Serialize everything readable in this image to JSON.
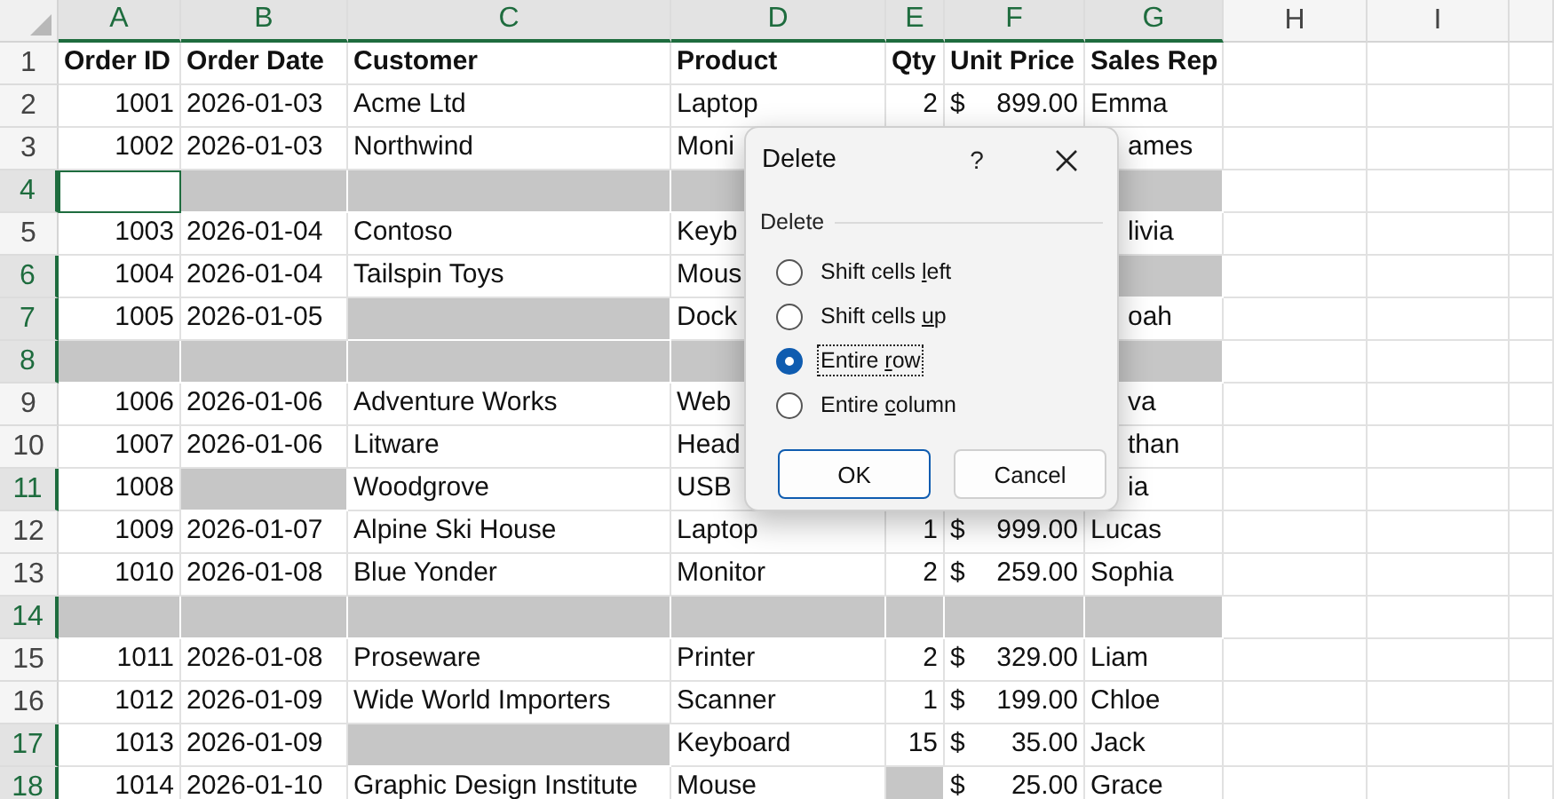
{
  "sheet": {
    "columns": [
      {
        "label": "A",
        "selected": true
      },
      {
        "label": "B",
        "selected": true
      },
      {
        "label": "C",
        "selected": true
      },
      {
        "label": "D",
        "selected": true
      },
      {
        "label": "E",
        "selected": true
      },
      {
        "label": "F",
        "selected": true
      },
      {
        "label": "G",
        "selected": true
      },
      {
        "label": "H",
        "selected": false
      },
      {
        "label": "I",
        "selected": false
      }
    ],
    "rows": [
      {
        "number": "1",
        "selected": false,
        "kind": "header",
        "cells": [
          {
            "text": "Order ID",
            "selected": false
          },
          {
            "text": "Order Date",
            "selected": false
          },
          {
            "text": "Customer",
            "selected": false
          },
          {
            "text": "Product",
            "selected": false
          },
          {
            "text": "Qty",
            "selected": false
          },
          {
            "text": "Unit Price",
            "selected": false
          },
          {
            "text": "Sales Rep",
            "selected": false
          }
        ]
      },
      {
        "number": "2",
        "selected": false,
        "kind": "data",
        "cells": [
          {
            "text": "1001",
            "selected": false
          },
          {
            "text": "2026-01-03",
            "selected": false
          },
          {
            "text": "Acme Ltd",
            "selected": false
          },
          {
            "text": "Laptop",
            "selected": false
          },
          {
            "text": "2",
            "selected": false
          },
          {
            "currency": "$",
            "amount": "899.00",
            "selected": false
          },
          {
            "text": "Emma",
            "selected": false
          }
        ]
      },
      {
        "number": "3",
        "selected": false,
        "kind": "data",
        "cells": [
          {
            "text": "1002",
            "selected": false
          },
          {
            "text": "2026-01-03",
            "selected": false
          },
          {
            "text": "Northwind",
            "selected": false
          },
          {
            "text": "Moni",
            "selected": false
          },
          null,
          null,
          {
            "text": "ames",
            "selected": false
          }
        ]
      },
      {
        "number": "4",
        "selected": true,
        "kind": "data",
        "cells": [
          {
            "active": true
          },
          {
            "selected": true
          },
          {
            "selected": true
          },
          {
            "selected": true
          },
          null,
          null,
          {
            "selected": true
          }
        ]
      },
      {
        "number": "5",
        "selected": false,
        "kind": "data",
        "cells": [
          {
            "text": "1003",
            "selected": false
          },
          {
            "text": "2026-01-04",
            "selected": false
          },
          {
            "text": "Contoso",
            "selected": false
          },
          {
            "text": "Keyb",
            "selected": false
          },
          null,
          null,
          {
            "text": "livia",
            "selected": false
          }
        ]
      },
      {
        "number": "6",
        "selected": true,
        "kind": "data",
        "cells": [
          {
            "text": "1004",
            "selected": false
          },
          {
            "text": "2026-01-04",
            "selected": false
          },
          {
            "text": "Tailspin Toys",
            "selected": false
          },
          {
            "text": "Mous",
            "selected": false
          },
          null,
          null,
          {
            "selected": true
          }
        ]
      },
      {
        "number": "7",
        "selected": true,
        "kind": "data",
        "cells": [
          {
            "text": "1005",
            "selected": false
          },
          {
            "text": "2026-01-05",
            "selected": false
          },
          {
            "selected": true
          },
          {
            "text": "Dock",
            "selected": false
          },
          null,
          null,
          {
            "text": "oah",
            "selected": false
          }
        ]
      },
      {
        "number": "8",
        "selected": true,
        "kind": "data",
        "cells": [
          {
            "selected": true
          },
          {
            "selected": true
          },
          {
            "selected": true
          },
          {
            "selected": true
          },
          null,
          null,
          {
            "selected": true
          }
        ]
      },
      {
        "number": "9",
        "selected": false,
        "kind": "data",
        "cells": [
          {
            "text": "1006",
            "selected": false
          },
          {
            "text": "2026-01-06",
            "selected": false
          },
          {
            "text": "Adventure Works",
            "selected": false
          },
          {
            "text": "Web",
            "selected": false
          },
          null,
          null,
          {
            "text": "va",
            "selected": false
          }
        ]
      },
      {
        "number": "10",
        "selected": false,
        "kind": "data",
        "cells": [
          {
            "text": "1007",
            "selected": false
          },
          {
            "text": "2026-01-06",
            "selected": false
          },
          {
            "text": "Litware",
            "selected": false
          },
          {
            "text": "Head",
            "selected": false
          },
          null,
          null,
          {
            "text": "than",
            "selected": false
          }
        ]
      },
      {
        "number": "11",
        "selected": true,
        "kind": "data",
        "cells": [
          {
            "text": "1008",
            "selected": false
          },
          {
            "selected": true
          },
          {
            "text": "Woodgrove",
            "selected": false
          },
          {
            "text": "USB",
            "selected": false
          },
          null,
          null,
          {
            "text": "ia",
            "selected": false
          }
        ]
      },
      {
        "number": "12",
        "selected": false,
        "kind": "data",
        "cells": [
          {
            "text": "1009",
            "selected": false
          },
          {
            "text": "2026-01-07",
            "selected": false
          },
          {
            "text": "Alpine Ski House",
            "selected": false
          },
          {
            "text": "Laptop",
            "selected": false
          },
          {
            "text": "1",
            "selected": false
          },
          {
            "currency": "$",
            "amount": "999.00",
            "selected": false
          },
          {
            "text": "Lucas",
            "selected": false
          }
        ]
      },
      {
        "number": "13",
        "selected": false,
        "kind": "data",
        "cells": [
          {
            "text": "1010",
            "selected": false
          },
          {
            "text": "2026-01-08",
            "selected": false
          },
          {
            "text": "Blue Yonder",
            "selected": false
          },
          {
            "text": "Monitor",
            "selected": false
          },
          {
            "text": "2",
            "selected": false
          },
          {
            "currency": "$",
            "amount": "259.00",
            "selected": false
          },
          {
            "text": "Sophia",
            "selected": false
          }
        ]
      },
      {
        "number": "14",
        "selected": true,
        "kind": "data",
        "cells": [
          {
            "selected": true
          },
          {
            "selected": true
          },
          {
            "selected": true
          },
          {
            "selected": true
          },
          {
            "selected": true
          },
          {
            "selected": true
          },
          {
            "selected": true
          }
        ]
      },
      {
        "number": "15",
        "selected": false,
        "kind": "data",
        "cells": [
          {
            "text": "1011",
            "selected": false
          },
          {
            "text": "2026-01-08",
            "selected": false
          },
          {
            "text": "Proseware",
            "selected": false
          },
          {
            "text": "Printer",
            "selected": false
          },
          {
            "text": "2",
            "selected": false
          },
          {
            "currency": "$",
            "amount": "329.00",
            "selected": false
          },
          {
            "text": "Liam",
            "selected": false
          }
        ]
      },
      {
        "number": "16",
        "selected": false,
        "kind": "data",
        "cells": [
          {
            "text": "1012",
            "selected": false
          },
          {
            "text": "2026-01-09",
            "selected": false
          },
          {
            "text": "Wide World Importers",
            "selected": false
          },
          {
            "text": "Scanner",
            "selected": false
          },
          {
            "text": "1",
            "selected": false
          },
          {
            "currency": "$",
            "amount": "199.00",
            "selected": false
          },
          {
            "text": "Chloe",
            "selected": false
          }
        ]
      },
      {
        "number": "17",
        "selected": true,
        "kind": "data",
        "cells": [
          {
            "text": "1013",
            "selected": false
          },
          {
            "text": "2026-01-09",
            "selected": false
          },
          {
            "selected": true
          },
          {
            "text": "Keyboard",
            "selected": false
          },
          {
            "text": "15",
            "selected": false
          },
          {
            "currency": "$",
            "amount": "35.00",
            "selected": false
          },
          {
            "text": "Jack",
            "selected": false
          }
        ]
      },
      {
        "number": "18",
        "selected": true,
        "kind": "data",
        "cells": [
          {
            "text": "1014",
            "selected": false
          },
          {
            "text": "2026-01-10",
            "selected": false
          },
          {
            "text": "Graphic Design Institute",
            "selected": false
          },
          {
            "text": "Mouse",
            "selected": false
          },
          {
            "selected": true
          },
          {
            "currency": "$",
            "amount": "25.00",
            "selected": false
          },
          {
            "text": "Grace",
            "selected": false
          }
        ]
      }
    ]
  },
  "dialog": {
    "title": "Delete",
    "help": "?",
    "group_label": "Delete",
    "options": [
      {
        "label_parts": [
          "Shift cells ",
          "l",
          "eft"
        ],
        "selected": false
      },
      {
        "label_parts": [
          "Shift cells ",
          "u",
          "p"
        ],
        "selected": false
      },
      {
        "label_parts": [
          "Entire ",
          "r",
          "ow"
        ],
        "selected": true
      },
      {
        "label_parts": [
          "Entire ",
          "c",
          "olumn"
        ],
        "selected": false
      }
    ],
    "buttons": [
      {
        "label": "OK",
        "default": true
      },
      {
        "label": "Cancel",
        "default": false
      }
    ]
  }
}
